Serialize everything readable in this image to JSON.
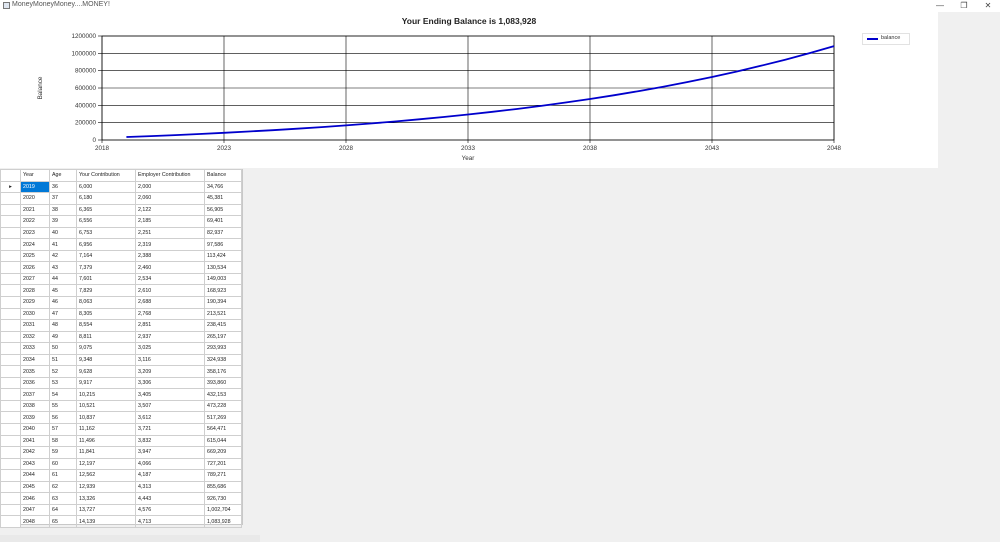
{
  "window": {
    "title": "MoneyMoneyMoney....MONEY!",
    "minimize_glyph": "—",
    "restore_glyph": "❐",
    "close_glyph": "✕"
  },
  "chart_data": {
    "type": "line",
    "title": "Your Ending Balance is 1,083,928",
    "xlabel": "Year",
    "ylabel": "Balance",
    "xlim": [
      2018,
      2048
    ],
    "ylim": [
      0,
      1200000
    ],
    "xticks": [
      2018,
      2023,
      2028,
      2033,
      2038,
      2043,
      2048
    ],
    "yticks": [
      0,
      200000,
      400000,
      600000,
      800000,
      1000000,
      1200000
    ],
    "grid": true,
    "legend_position": "top-right",
    "series": [
      {
        "name": "balance",
        "color": "#0000cc",
        "x": [
          2019,
          2020,
          2021,
          2022,
          2023,
          2024,
          2025,
          2026,
          2027,
          2028,
          2029,
          2030,
          2031,
          2032,
          2033,
          2034,
          2035,
          2036,
          2037,
          2038,
          2039,
          2040,
          2041,
          2042,
          2043,
          2044,
          2045,
          2046,
          2047,
          2048
        ],
        "y": [
          34766,
          45381,
          56905,
          69401,
          82937,
          97586,
          113424,
          130534,
          149003,
          168923,
          190394,
          213521,
          238415,
          265197,
          293993,
          324938,
          358176,
          393860,
          432153,
          473228,
          517269,
          564471,
          615044,
          669209,
          727201,
          789271,
          855686,
          926730,
          1002704,
          1083928
        ]
      }
    ]
  },
  "grid": {
    "columns": [
      "Year",
      "Age",
      "Your Contribution",
      "Employer Contribution",
      "Balance"
    ],
    "rows": [
      [
        "2019",
        "36",
        "6,000",
        "2,000",
        "34,766"
      ],
      [
        "2020",
        "37",
        "6,180",
        "2,060",
        "45,381"
      ],
      [
        "2021",
        "38",
        "6,365",
        "2,122",
        "56,905"
      ],
      [
        "2022",
        "39",
        "6,556",
        "2,185",
        "69,401"
      ],
      [
        "2023",
        "40",
        "6,753",
        "2,251",
        "82,937"
      ],
      [
        "2024",
        "41",
        "6,956",
        "2,319",
        "97,586"
      ],
      [
        "2025",
        "42",
        "7,164",
        "2,388",
        "113,424"
      ],
      [
        "2026",
        "43",
        "7,379",
        "2,460",
        "130,534"
      ],
      [
        "2027",
        "44",
        "7,601",
        "2,534",
        "149,003"
      ],
      [
        "2028",
        "45",
        "7,829",
        "2,610",
        "168,923"
      ],
      [
        "2029",
        "46",
        "8,063",
        "2,688",
        "190,394"
      ],
      [
        "2030",
        "47",
        "8,305",
        "2,768",
        "213,521"
      ],
      [
        "2031",
        "48",
        "8,554",
        "2,851",
        "238,415"
      ],
      [
        "2032",
        "49",
        "8,811",
        "2,937",
        "265,197"
      ],
      [
        "2033",
        "50",
        "9,075",
        "3,025",
        "293,993"
      ],
      [
        "2034",
        "51",
        "9,348",
        "3,116",
        "324,938"
      ],
      [
        "2035",
        "52",
        "9,628",
        "3,209",
        "358,176"
      ],
      [
        "2036",
        "53",
        "9,917",
        "3,306",
        "393,860"
      ],
      [
        "2037",
        "54",
        "10,215",
        "3,405",
        "432,153"
      ],
      [
        "2038",
        "55",
        "10,521",
        "3,507",
        "473,228"
      ],
      [
        "2039",
        "56",
        "10,837",
        "3,612",
        "517,269"
      ],
      [
        "2040",
        "57",
        "11,162",
        "3,721",
        "564,471"
      ],
      [
        "2041",
        "58",
        "11,496",
        "3,832",
        "615,044"
      ],
      [
        "2042",
        "59",
        "11,841",
        "3,947",
        "669,209"
      ],
      [
        "2043",
        "60",
        "12,197",
        "4,066",
        "727,201"
      ],
      [
        "2044",
        "61",
        "12,562",
        "4,187",
        "789,271"
      ],
      [
        "2045",
        "62",
        "12,939",
        "4,313",
        "855,686"
      ],
      [
        "2046",
        "63",
        "13,326",
        "4,443",
        "926,730"
      ],
      [
        "2047",
        "64",
        "13,727",
        "4,576",
        "1,002,704"
      ],
      [
        "2048",
        "65",
        "14,139",
        "4,713",
        "1,083,928"
      ]
    ],
    "row_indicator": "▸",
    "selection_color": "#0078d7"
  }
}
